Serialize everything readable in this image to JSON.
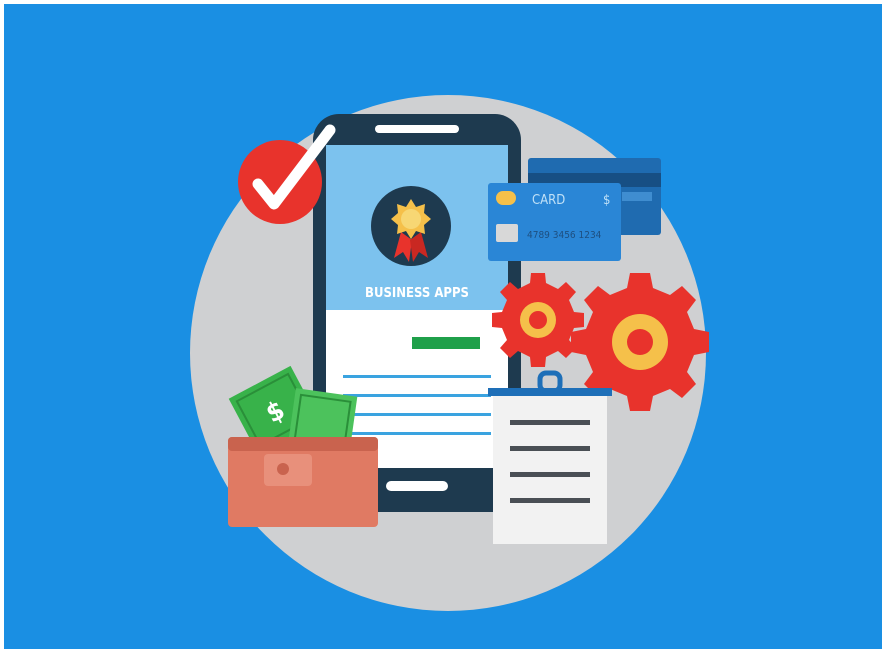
{
  "colors": {
    "background": "#1a8fe3",
    "circle": "#cfd0d2",
    "phone_body": "#1e3a4f",
    "phone_screen_top": "#7cc2ee",
    "accent_green": "#1fa04a",
    "gear_red": "#e8332c",
    "gear_yellow": "#f5c04a",
    "card_blue": "#1d6fb8",
    "wallet": "#e07a63",
    "check_red": "#e8332c"
  },
  "phone": {
    "title": "BUSINESS APPS"
  },
  "card": {
    "label": "CARD",
    "symbol": "$",
    "number": "4789 3456 1234"
  },
  "icons": {
    "badge": "award-badge-icon",
    "check": "checkmark-icon",
    "gears": "gears-icon",
    "wallet": "wallet-icon",
    "money": "dollar-bills-icon",
    "clipboard": "clipboard-icon",
    "cards": "credit-cards-icon"
  }
}
